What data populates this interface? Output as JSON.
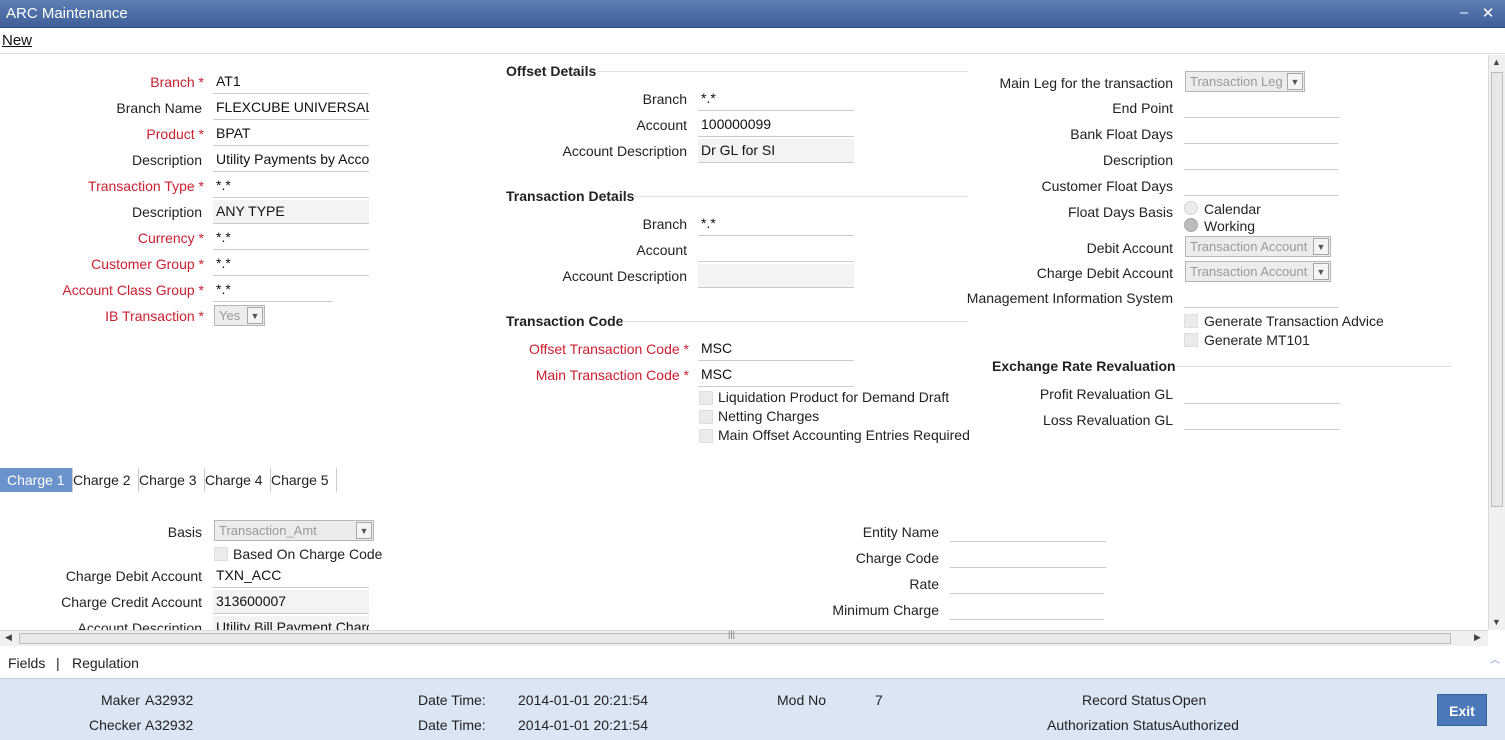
{
  "window": {
    "title": "ARC Maintenance",
    "minimize": "–",
    "close": "✕"
  },
  "menu": {
    "new": "New"
  },
  "main": {
    "branch": {
      "label": "Branch",
      "value": "AT1"
    },
    "branch_name": {
      "label": "Branch Name",
      "value": "FLEXCUBE UNIVERSAL I"
    },
    "product": {
      "label": "Product",
      "value": "BPAT"
    },
    "product_description": {
      "label": "Description",
      "value": "Utility Payments by Acco"
    },
    "transaction_type": {
      "label": "Transaction Type",
      "value": "*.*"
    },
    "type_description": {
      "label": "Description",
      "value": "ANY TYPE"
    },
    "currency": {
      "label": "Currency",
      "value": "*.*"
    },
    "customer_group": {
      "label": "Customer Group",
      "value": "*.*"
    },
    "account_class_group": {
      "label": "Account Class Group",
      "value": "*.*"
    },
    "ib_transaction": {
      "label": "IB Transaction",
      "value": "Yes"
    }
  },
  "offset_details": {
    "heading": "Offset Details",
    "branch": {
      "label": "Branch",
      "value": "*.*"
    },
    "account": {
      "label": "Account",
      "value": "100000099"
    },
    "account_description": {
      "label": "Account Description",
      "value": "Dr GL for SI"
    }
  },
  "transaction_details": {
    "heading": "Transaction Details",
    "branch": {
      "label": "Branch",
      "value": "*.*"
    },
    "account": {
      "label": "Account",
      "value": ""
    },
    "account_description": {
      "label": "Account Description",
      "value": ""
    }
  },
  "transaction_code": {
    "heading": "Transaction Code",
    "offset_code": {
      "label": "Offset Transaction Code",
      "value": "MSC"
    },
    "main_code": {
      "label": "Main Transaction Code",
      "value": "MSC"
    },
    "liquidation_product": "Liquidation Product for Demand Draft",
    "netting_charges": "Netting Charges",
    "main_offset_entries": "Main Offset Accounting Entries Required"
  },
  "right": {
    "main_leg": {
      "label": "Main Leg for the transaction",
      "value": "Transaction Leg"
    },
    "end_point": {
      "label": "End Point",
      "value": ""
    },
    "bank_float_days": {
      "label": "Bank Float Days",
      "value": ""
    },
    "description": {
      "label": "Description",
      "value": ""
    },
    "customer_float_days": {
      "label": "Customer Float Days",
      "value": ""
    },
    "float_days_basis": {
      "label": "Float Days Basis",
      "options": [
        "Calendar",
        "Working"
      ],
      "selected": "Working"
    },
    "debit_account": {
      "label": "Debit Account",
      "value": "Transaction Account"
    },
    "charge_debit_account": {
      "label": "Charge Debit Account",
      "value": "Transaction Account"
    },
    "mis": {
      "label": "Management Information System",
      "value": ""
    },
    "generate_advice": "Generate Transaction Advice",
    "generate_mt101": "Generate MT101"
  },
  "exchange_rate": {
    "heading": "Exchange Rate Revaluation",
    "profit_gl": {
      "label": "Profit Revaluation GL",
      "value": ""
    },
    "loss_gl": {
      "label": "Loss Revaluation GL",
      "value": ""
    }
  },
  "tabs": [
    "Charge 1",
    "Charge 2",
    "Charge 3",
    "Charge 4",
    "Charge 5"
  ],
  "charge": {
    "basis": {
      "label": "Basis",
      "value": "Transaction_Amt"
    },
    "based_on_charge_code": "Based On Charge Code",
    "charge_debit_account": {
      "label": "Charge Debit Account",
      "value": "TXN_ACC"
    },
    "charge_credit_account": {
      "label": "Charge Credit Account",
      "value": "313600007"
    },
    "account_description": {
      "label": "Account Description",
      "value": "Utility Bill Payment Charg"
    },
    "entity_name": {
      "label": "Entity Name",
      "value": ""
    },
    "charge_code": {
      "label": "Charge Code",
      "value": ""
    },
    "rate": {
      "label": "Rate",
      "value": ""
    },
    "minimum_charge": {
      "label": "Minimum Charge",
      "value": ""
    }
  },
  "bottom": {
    "fields": "Fields",
    "separator": "|",
    "regulation": "Regulation"
  },
  "footer": {
    "maker_label": "Maker",
    "maker": "A32932",
    "checker_label": "Checker",
    "checker": "A32932",
    "datetime_label": "Date Time:",
    "maker_datetime": "2014-01-01 20:21:54",
    "checker_datetime": "2014-01-01 20:21:54",
    "mod_no_label": "Mod No",
    "mod_no": "7",
    "record_status_label": "Record Status",
    "record_status": "Open",
    "auth_status_label": "Authorization Status",
    "auth_status": "Authorized",
    "exit": "Exit"
  }
}
